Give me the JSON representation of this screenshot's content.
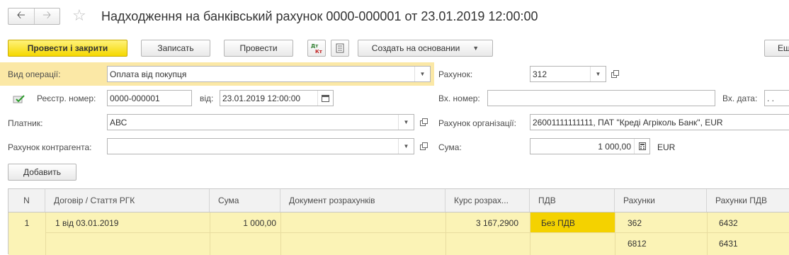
{
  "window": {
    "title": "Надходження на банківський рахунок 0000-000001 от 23.01.2019 12:00:00"
  },
  "nav": {
    "back_icon": "arrow-left-icon",
    "forward_icon": "arrow-right-icon",
    "favorite_icon": "star-icon"
  },
  "toolbar": {
    "post_close": "Провести і закрити",
    "save": "Записать",
    "post": "Провести",
    "dtkt_icon": "dt-kt-icon",
    "report_icon": "document-icon",
    "create_based": "Создать на основании",
    "more": "Еще"
  },
  "form": {
    "operation_label": "Вид операції:",
    "operation_value": "Оплата від покупця",
    "reg_label": "Реєстр. номер:",
    "reg_value": "0000-000001",
    "date_label": "від:",
    "date_value": "23.01.2019 12:00:00",
    "payer_label": "Платник:",
    "payer_value": "АВС",
    "cp_account_label": "Рахунок контрагента:",
    "cp_account_value": "",
    "account_label": "Рахунок:",
    "account_value": "312",
    "in_num_label": "Вх. номер:",
    "in_num_value": "",
    "in_date_label": "Вх. дата:",
    "in_date_value": ". .",
    "org_account_label": "Рахунок організації:",
    "org_account_value": "26001111111111, ПАТ \"Креді Агріколь Банк\", EUR",
    "sum_label": "Сума:",
    "sum_value": "1 000,00",
    "currency": "EUR"
  },
  "add_button": "Добавить",
  "table": {
    "columns": [
      "N",
      "Договір / Стаття РГК",
      "Сума",
      "Документ розрахунків",
      "Курс розрах...",
      "ПДВ",
      "Рахунки",
      "Рахунки ПДВ"
    ],
    "rows": [
      {
        "n": "1",
        "contract": "1 від 03.01.2019",
        "sum": "1 000,00",
        "doc": "",
        "rate": "3 167,2900",
        "vat": "Без ПДВ",
        "accounts": [
          "362",
          "6812"
        ],
        "vat_accounts": [
          "6432",
          "6431"
        ]
      }
    ]
  }
}
